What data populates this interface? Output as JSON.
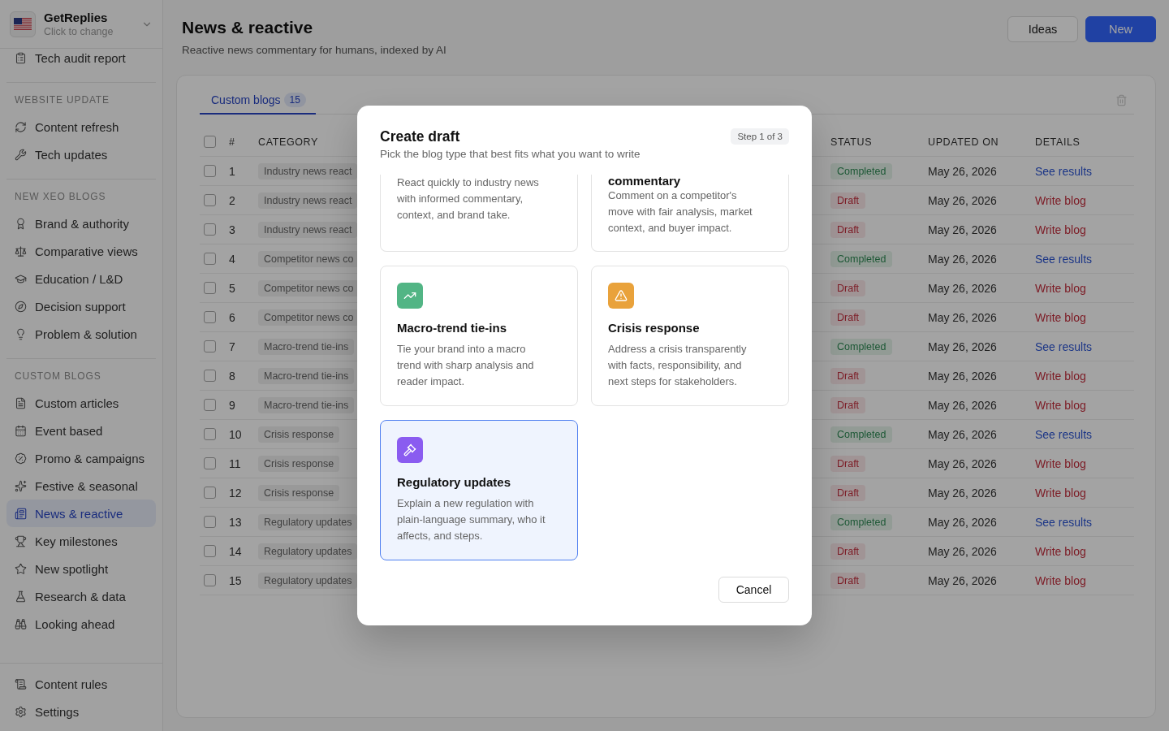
{
  "sidebar": {
    "workspace": {
      "name": "GetReplies",
      "hint": "Click to change"
    },
    "sections": [
      {
        "items": [
          {
            "label": "Tech audit report",
            "selected": false
          }
        ]
      },
      {
        "title": "WEBSITE UPDATE",
        "items": [
          {
            "label": "Content refresh",
            "selected": false
          },
          {
            "label": "Tech updates",
            "selected": false
          }
        ]
      },
      {
        "title": "NEW XEO BLOGS",
        "items": [
          {
            "label": "Brand & authority",
            "selected": false
          },
          {
            "label": "Comparative views",
            "selected": false
          },
          {
            "label": "Education / L&D",
            "selected": false
          },
          {
            "label": "Decision support",
            "selected": false
          },
          {
            "label": "Problem & solution",
            "selected": false
          }
        ]
      },
      {
        "title": "CUSTOM BLOGS",
        "items": [
          {
            "label": "Custom articles",
            "selected": false
          },
          {
            "label": "Event based",
            "selected": false
          },
          {
            "label": "Promo & campaigns",
            "selected": false
          },
          {
            "label": "Festive & seasonal",
            "selected": false
          },
          {
            "label": "News & reactive",
            "selected": true
          },
          {
            "label": "Key milestones",
            "selected": false
          },
          {
            "label": "New spotlight",
            "selected": false
          },
          {
            "label": "Research & data",
            "selected": false
          },
          {
            "label": "Looking ahead",
            "selected": false
          }
        ]
      }
    ],
    "footer_items": [
      {
        "label": "Content rules",
        "selected": false
      },
      {
        "label": "Settings",
        "selected": false
      }
    ]
  },
  "header": {
    "title": "News & reactive",
    "subtitle": "Reactive news commentary for humans, indexed by AI",
    "buttons": [
      {
        "label": "Ideas",
        "kind": "secondary"
      },
      {
        "label": "New",
        "kind": "primary"
      }
    ]
  },
  "panel": {
    "tabs": [
      {
        "label": "Custom blogs",
        "count": "15",
        "selected": true
      }
    ],
    "table": {
      "select_all": {
        "checked": false
      },
      "columns": [
        "#",
        "CATEGORY",
        "STATUS",
        "UPDATED ON",
        "DETAILS"
      ],
      "rows": [
        {
          "checked": false,
          "number": "1",
          "category": "Industry news react",
          "kind": "completed",
          "status": "Completed",
          "updated": "May 26, 2026",
          "details": "See results"
        },
        {
          "checked": false,
          "number": "2",
          "category": "Industry news react",
          "kind": "draft",
          "status": "Draft",
          "updated": "May 26, 2026",
          "details": "Write blog"
        },
        {
          "checked": false,
          "number": "3",
          "category": "Industry news react",
          "kind": "draft",
          "status": "Draft",
          "updated": "May 26, 2026",
          "details": "Write blog"
        },
        {
          "checked": false,
          "number": "4",
          "category": "Competitor news co",
          "kind": "completed",
          "status": "Completed",
          "updated": "May 26, 2026",
          "details": "See results"
        },
        {
          "checked": false,
          "number": "5",
          "category": "Competitor news co",
          "kind": "draft",
          "status": "Draft",
          "updated": "May 26, 2026",
          "details": "Write blog"
        },
        {
          "checked": false,
          "number": "6",
          "category": "Competitor news co",
          "kind": "draft",
          "status": "Draft",
          "updated": "May 26, 2026",
          "details": "Write blog"
        },
        {
          "checked": false,
          "number": "7",
          "category": "Macro-trend tie-ins",
          "kind": "completed",
          "status": "Completed",
          "updated": "May 26, 2026",
          "details": "See results"
        },
        {
          "checked": false,
          "number": "8",
          "category": "Macro-trend tie-ins",
          "kind": "draft",
          "status": "Draft",
          "updated": "May 26, 2026",
          "details": "Write blog"
        },
        {
          "checked": false,
          "number": "9",
          "category": "Macro-trend tie-ins",
          "kind": "draft",
          "status": "Draft",
          "updated": "May 26, 2026",
          "details": "Write blog"
        },
        {
          "checked": false,
          "number": "10",
          "category": "Crisis response",
          "kind": "completed",
          "status": "Completed",
          "updated": "May 26, 2026",
          "details": "See results"
        },
        {
          "checked": false,
          "number": "11",
          "category": "Crisis response",
          "kind": "draft",
          "status": "Draft",
          "updated": "May 26, 2026",
          "details": "Write blog"
        },
        {
          "checked": false,
          "number": "12",
          "category": "Crisis response",
          "kind": "draft",
          "status": "Draft",
          "updated": "May 26, 2026",
          "details": "Write blog"
        },
        {
          "checked": false,
          "number": "13",
          "category": "Regulatory updates",
          "kind": "completed",
          "status": "Completed",
          "updated": "May 26, 2026",
          "details": "See results"
        },
        {
          "checked": false,
          "number": "14",
          "category": "Regulatory updates",
          "kind": "draft",
          "status": "Draft",
          "updated": "May 26, 2026",
          "details": "Write blog"
        },
        {
          "checked": false,
          "number": "15",
          "category": "Regulatory updates",
          "kind": "draft",
          "status": "Draft",
          "updated": "May 26, 2026",
          "details": "Write blog"
        }
      ]
    }
  },
  "modal": {
    "title": "Create draft",
    "subtitle": "Pick the blog type that best fits what you want to write",
    "step": "Step 1 of 3",
    "cards": [
      {
        "description": "React quickly to industry news with informed commentary, context, and brand take.",
        "selected": false
      },
      {
        "title": "commentary",
        "description": "Comment on a competitor's move with fair analysis, market context, and buyer impact.",
        "selected": false
      },
      {
        "title": "Macro-trend tie-ins",
        "description": "Tie your brand into a macro trend with sharp analysis and reader impact.",
        "color": "#52b585",
        "selected": false
      },
      {
        "title": "Crisis response",
        "description": "Address a crisis transparently with facts, responsibility, and next steps for stakeholders.",
        "color": "#e9a23b",
        "selected": false
      },
      {
        "title": "Regulatory updates",
        "description": "Explain a new regulation with plain-language summary, who it affects, and steps.",
        "color": "#8a5cf0",
        "selected": true
      }
    ],
    "cancel": "Cancel"
  }
}
